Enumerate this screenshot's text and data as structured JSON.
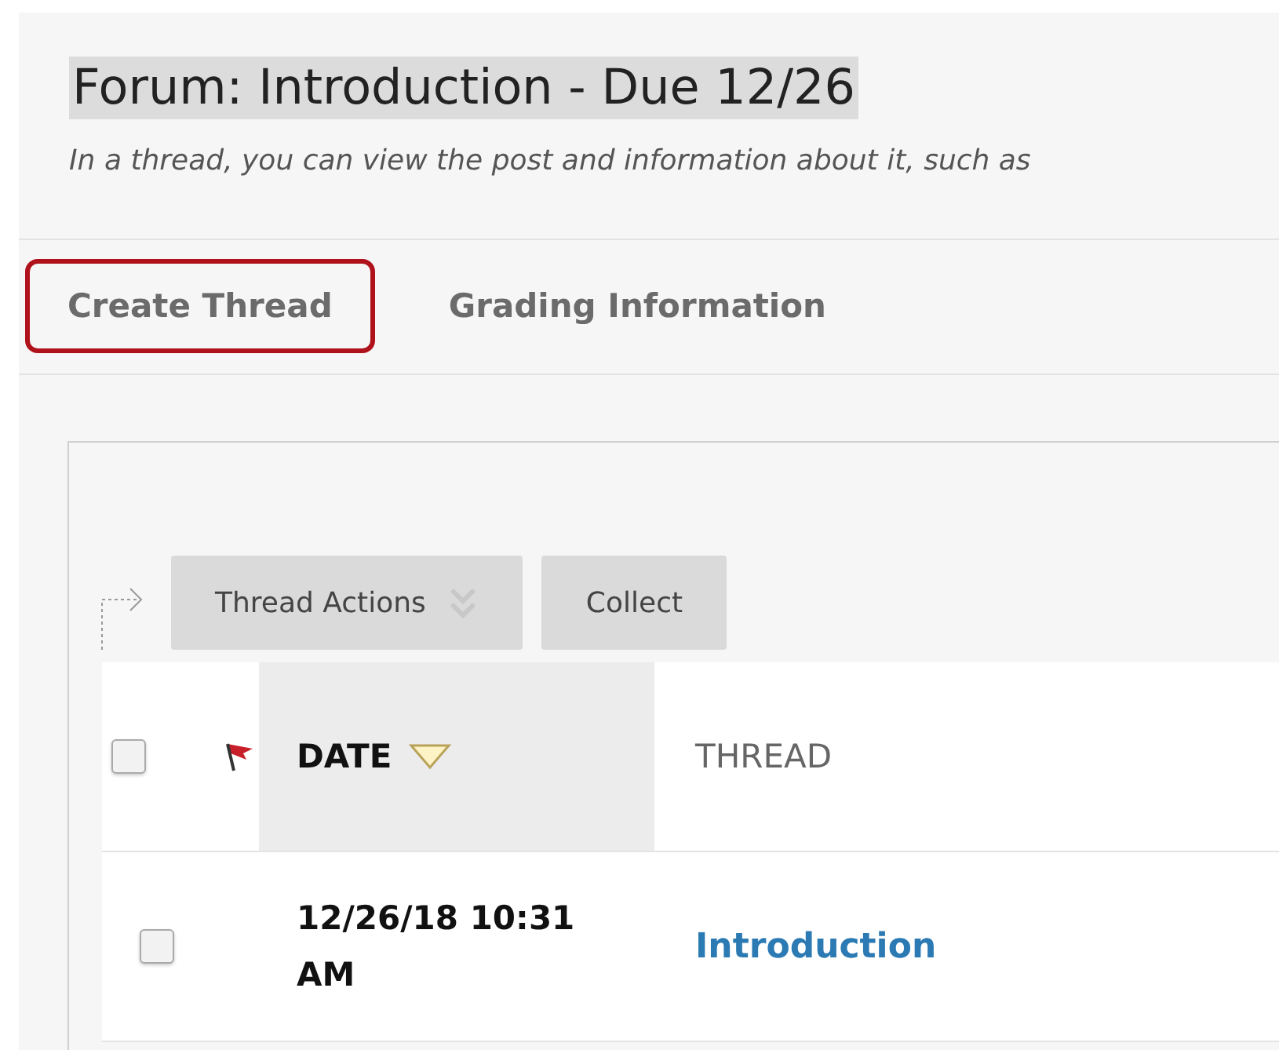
{
  "page": {
    "title": "Forum: Introduction - Due 12/26",
    "description": "In a thread, you can view the post and information about it, such as"
  },
  "actions": [
    {
      "label": "Create Thread",
      "highlighted": true
    },
    {
      "label": "Grading Information",
      "highlighted": false
    }
  ],
  "toolbar": [
    {
      "label": "Thread Actions",
      "kind": "menu"
    },
    {
      "label": "Collect",
      "kind": "button"
    }
  ],
  "table": {
    "select_all": {
      "checked": false
    },
    "columns": [
      {
        "label": "DATE",
        "sorted": true
      },
      {
        "label": "THREAD",
        "sorted": false
      }
    ],
    "rows": [
      {
        "checked": false,
        "date": "12/26/18 10:31 AM",
        "thread": "Introduction"
      }
    ]
  }
}
